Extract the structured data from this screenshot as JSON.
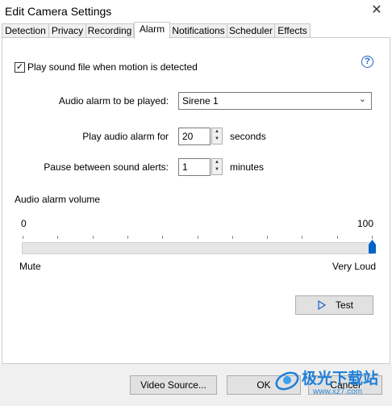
{
  "window": {
    "title": "Edit Camera Settings",
    "close_glyph": "✕"
  },
  "tabs": [
    {
      "label": "Detection"
    },
    {
      "label": "Privacy"
    },
    {
      "label": "Recording"
    },
    {
      "label": "Alarm",
      "active": true
    },
    {
      "label": "Notifications"
    },
    {
      "label": "Scheduler"
    },
    {
      "label": "Effects"
    }
  ],
  "alarm": {
    "help_glyph": "?",
    "play_sound_checkbox": {
      "label": "Play sound file when motion is detected",
      "checked": true,
      "mark": "✓"
    },
    "audio_alarm": {
      "label": "Audio alarm to be played:",
      "value": "Sirene 1",
      "arrow": "⌄"
    },
    "play_for": {
      "label": "Play audio alarm for",
      "value": "20",
      "unit": "seconds"
    },
    "pause_between": {
      "label": "Pause between sound alerts:",
      "value": "1",
      "unit": "minutes"
    },
    "volume": {
      "label": "Audio alarm volume",
      "min": "0",
      "max": "100",
      "value": 100,
      "min_label": "Mute",
      "max_label": "Very Loud"
    },
    "test_button": {
      "label": "Test"
    }
  },
  "footer": {
    "video_source_button": "Video Source...",
    "ok_button": "OK",
    "cancel_button": "Cancel"
  },
  "watermark": {
    "text": "极光下载站",
    "subtext": "www.xz7.com"
  },
  "colors": {
    "accent": "#0063c6",
    "help_blue": "#1e63c8"
  }
}
